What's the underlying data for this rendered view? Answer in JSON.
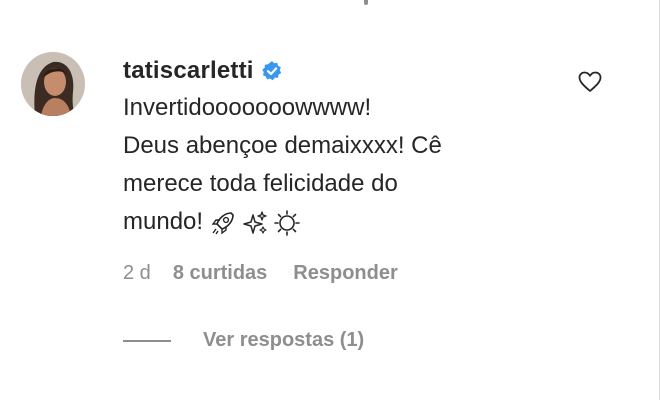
{
  "comment": {
    "username": "tatiscarletti",
    "verified": true,
    "text_lines": [
      "Invertidooooooowwww!",
      "Deus abençoe demaixxxx! Cê",
      "merece toda felicidade do",
      "mundo!"
    ],
    "emojis": [
      "rocket-icon",
      "sparkles-icon",
      "sun-icon"
    ],
    "date": "2 d",
    "likes": "8 curtidas",
    "reply_label": "Responder",
    "view_replies_label": "Ver respostas (1)"
  },
  "icons": {
    "verified": "verified-badge-icon",
    "like": "heart-outline-icon"
  },
  "colors": {
    "text": "#262626",
    "secondary": "#8e8e8e",
    "verified_blue": "#3897f0"
  }
}
